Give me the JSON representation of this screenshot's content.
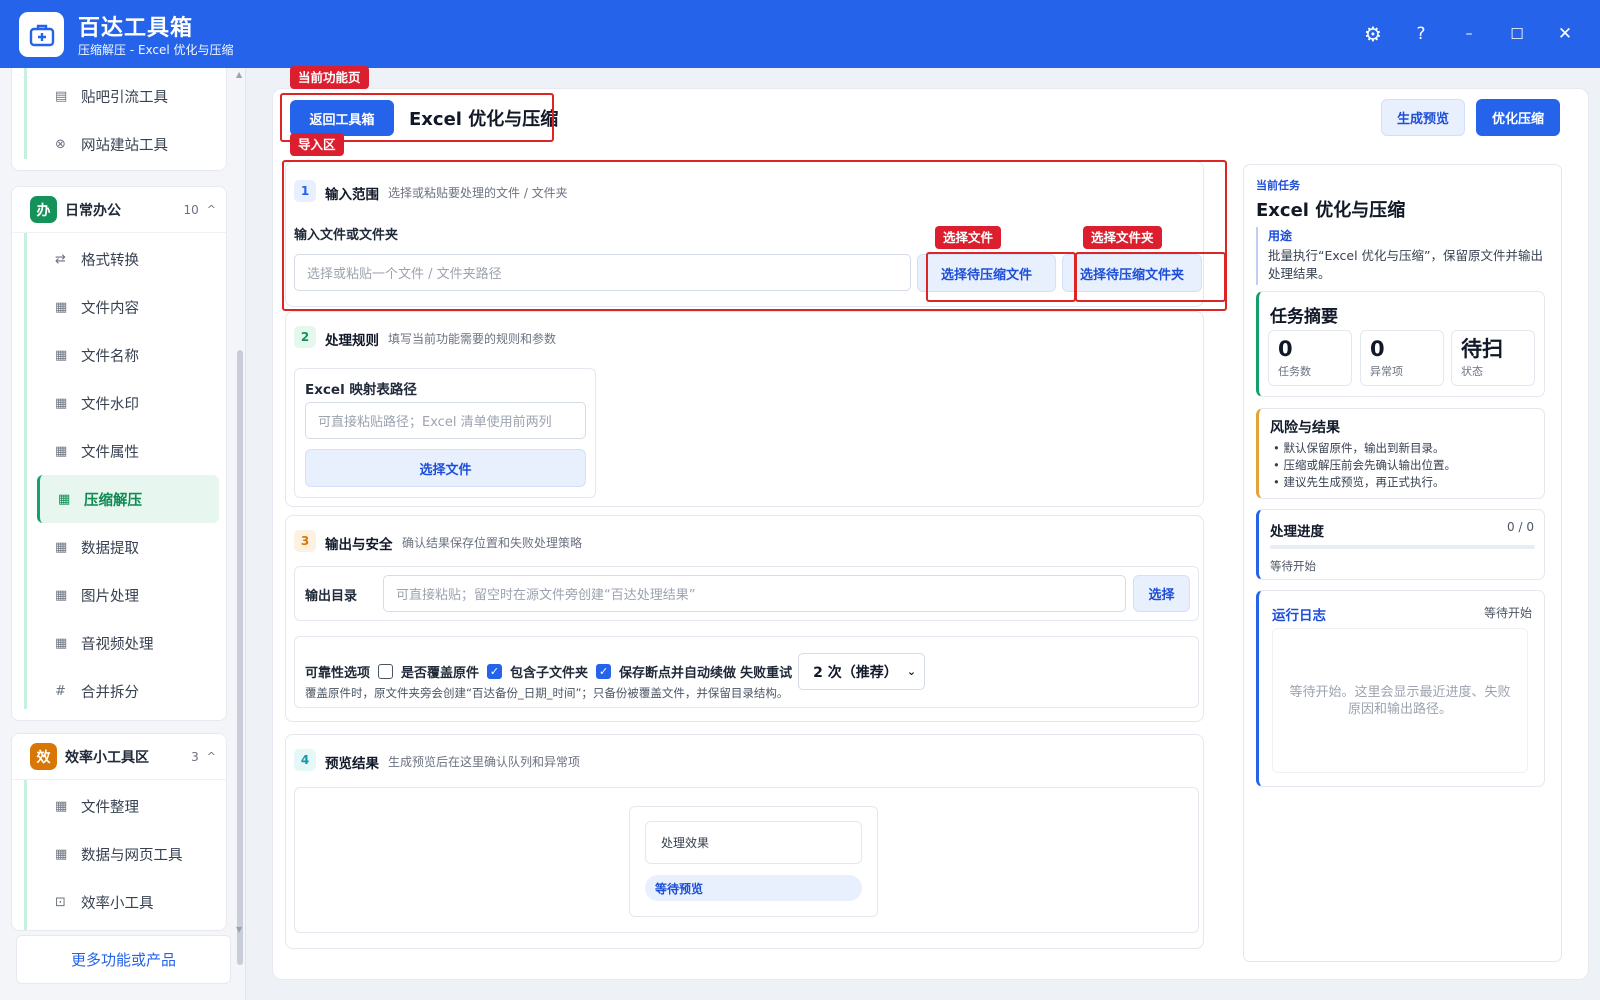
{
  "app": {
    "title": "百达工具箱",
    "subtitle": "压缩解压 - Excel 优化与压缩"
  },
  "window_controls": [
    "gear-icon",
    "help-icon",
    "minimize-icon",
    "maximize-icon",
    "close-icon"
  ],
  "window_glyphs": {
    "settings": "⚙",
    "help": "?",
    "minimize": "–",
    "maximize": "☐",
    "close": "✕"
  },
  "colors": {
    "primary": "#2563eb",
    "annotation_red": "#dc1f2e",
    "active_green": "#0f8a52"
  },
  "sidebar": {
    "top_items": [
      {
        "icon": "▤",
        "label": "贴吧引流工具"
      },
      {
        "icon": "⊗",
        "label": "网站建站工具"
      }
    ],
    "groups": [
      {
        "badge": "办",
        "title": "日常办公",
        "count": "10",
        "caret": "^",
        "items": [
          {
            "icon": "⇄",
            "label": "格式转换"
          },
          {
            "icon": "▦",
            "label": "文件内容"
          },
          {
            "icon": "▦",
            "label": "文件名称"
          },
          {
            "icon": "▦",
            "label": "文件水印"
          },
          {
            "icon": "▦",
            "label": "文件属性"
          },
          {
            "icon": "▦",
            "label": "压缩解压",
            "active": true
          },
          {
            "icon": "▦",
            "label": "数据提取"
          },
          {
            "icon": "▦",
            "label": "图片处理"
          },
          {
            "icon": "▦",
            "label": "音视频处理"
          },
          {
            "icon": "#",
            "label": "合并拆分"
          }
        ]
      },
      {
        "badge": "效",
        "title": "效率小工具区",
        "count": "3",
        "caret": "^",
        "items": [
          {
            "icon": "▦",
            "label": "文件整理"
          },
          {
            "icon": "▦",
            "label": "数据与网页工具"
          },
          {
            "icon": "⊡",
            "label": "效率小工具"
          }
        ]
      }
    ],
    "more_label": "更多功能或产品"
  },
  "annotations": {
    "current_page": "当前功能页",
    "import_area": "导入区",
    "select_file": "选择文件",
    "select_folder": "选择文件夹"
  },
  "header": {
    "back_button": "返回工具箱",
    "page_title": "Excel 优化与压缩",
    "preview_button": "生成预览",
    "run_button": "优化压缩"
  },
  "steps": {
    "s1": {
      "num": "1",
      "title": "输入范围",
      "desc": "选择或粘贴要处理的文件 / 文件夹",
      "field_label": "输入文件或文件夹",
      "placeholder": "选择或粘贴一个文件 / 文件夹路径",
      "btn_file": "选择待压缩文件",
      "btn_folder": "选择待压缩文件夹"
    },
    "s2": {
      "num": "2",
      "title": "处理规则",
      "desc": "填写当前功能需要的规则和参数",
      "field_label": "Excel 映射表路径",
      "placeholder": "可直接粘贴路径；Excel 清单使用前两列",
      "btn": "选择文件"
    },
    "s3": {
      "num": "3",
      "title": "输出与安全",
      "desc": "确认结果保存位置和失败处理策略",
      "output_label": "输出目录",
      "output_placeholder": "可直接粘贴；留空时在源文件旁创建“百达处理结果”",
      "output_btn": "选择",
      "reliability_label": "可靠性选项",
      "opt_overwrite": "是否覆盖原件",
      "opt_subfolders": "包含子文件夹",
      "opt_resume": "保存断点并自动续做",
      "retry_label": "失败重试",
      "retry_value": "2 次（推荐）",
      "note": "覆盖原件时，原文件夹旁会创建“百达备份_日期_时间”；只备份被覆盖文件，并保留目录结构。"
    },
    "s4": {
      "num": "4",
      "title": "预览结果",
      "desc": "生成预览后在这里确认队列和异常项",
      "effect_label": "处理效果",
      "status": "等待预览"
    }
  },
  "right_panel": {
    "task_tag": "当前任务",
    "task_title": "Excel 优化与压缩",
    "purpose_label": "用途",
    "purpose_text": "批量执行“Excel 优化与压缩”，保留原文件并输出处理结果。",
    "summary_title": "任务摘要",
    "stats": [
      {
        "value": "0",
        "label": "任务数"
      },
      {
        "value": "0",
        "label": "异常项"
      },
      {
        "value": "待扫",
        "label": "状态"
      }
    ],
    "risk_title": "风险与结果",
    "risk_items": [
      "默认保留原件，输出到新目录。",
      "压缩或解压前会先确认输出位置。",
      "建议先生成预览，再正式执行。"
    ],
    "progress_title": "处理进度",
    "progress_count": "0 / 0",
    "progress_value": 0,
    "progress_status": "等待开始",
    "log_title": "运行日志",
    "log_status": "等待开始",
    "log_placeholder": "等待开始。这里会显示最近进度、失败原因和输出路径。"
  }
}
